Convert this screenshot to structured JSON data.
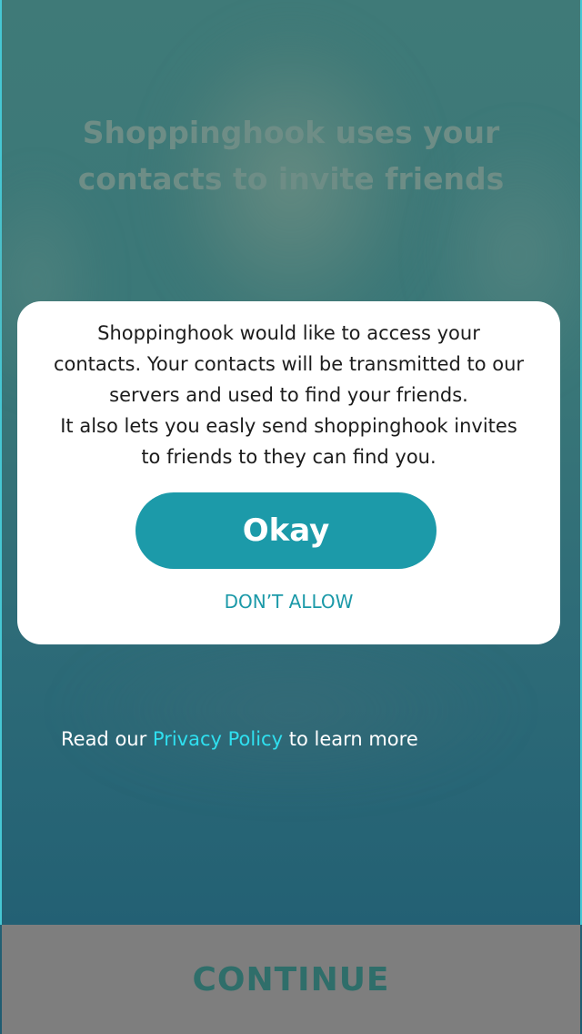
{
  "background": {
    "headline_line1": "Shoppinghook uses your",
    "headline_line2": "contacts to invite friends"
  },
  "dialog": {
    "message_lines": [
      "Shoppinghook would like to access your",
      "contacts. Your contacts will be transmitted to our",
      "servers and used to find your friends.",
      "It also lets you easly send shoppinghook invites",
      "to friends to they can find you."
    ],
    "okay_label": "Okay",
    "dont_allow_label": "DON’T ALLOW"
  },
  "privacy": {
    "prefix": "Read our ",
    "link_label": "Privacy Policy",
    "suffix": " to learn more"
  },
  "footer": {
    "continue_label": "CONTINUE"
  },
  "colors": {
    "accent": "#1c9aa9",
    "link": "#2fe0f0",
    "footer_bg": "#7e7e7e",
    "dialog_bg": "#ffffff"
  }
}
